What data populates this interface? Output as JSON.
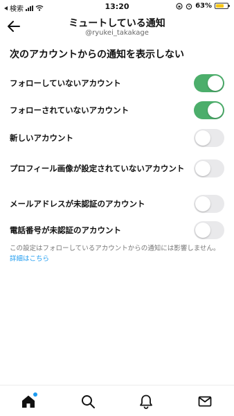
{
  "status_bar": {
    "carrier": "検索",
    "time": "13:20",
    "battery": "63%",
    "battery_color": "#f5c518"
  },
  "header": {
    "title": "ミュートしている通知",
    "subtitle": "@ryukei_takakage"
  },
  "section": {
    "title": "次のアカウントからの通知を表示しない"
  },
  "settings": [
    {
      "label": "フォローしていないアカウント",
      "enabled": true
    },
    {
      "label": "フォローされていないアカウント",
      "enabled": true
    },
    {
      "label": "新しいアカウント",
      "enabled": false
    },
    {
      "label": "プロフィール画像が設定されていないアカウント",
      "enabled": false
    },
    {
      "label": "メールアドレスが未認証のアカウント",
      "enabled": false
    },
    {
      "label": "電話番号が未認証のアカウント",
      "enabled": false
    }
  ],
  "note": {
    "text": "この設定はフォローしているアカウントからの通知には影響しません。",
    "link": "詳細はこちら"
  },
  "tabs": [
    {
      "icon": "home-icon",
      "has_notification_dot": true
    },
    {
      "icon": "search-icon"
    },
    {
      "icon": "bell-icon"
    },
    {
      "icon": "mail-icon"
    }
  ],
  "colors": {
    "toggle_on": "#4cae6b",
    "toggle_off": "#e9e9eb",
    "link": "#1d9bf0"
  }
}
